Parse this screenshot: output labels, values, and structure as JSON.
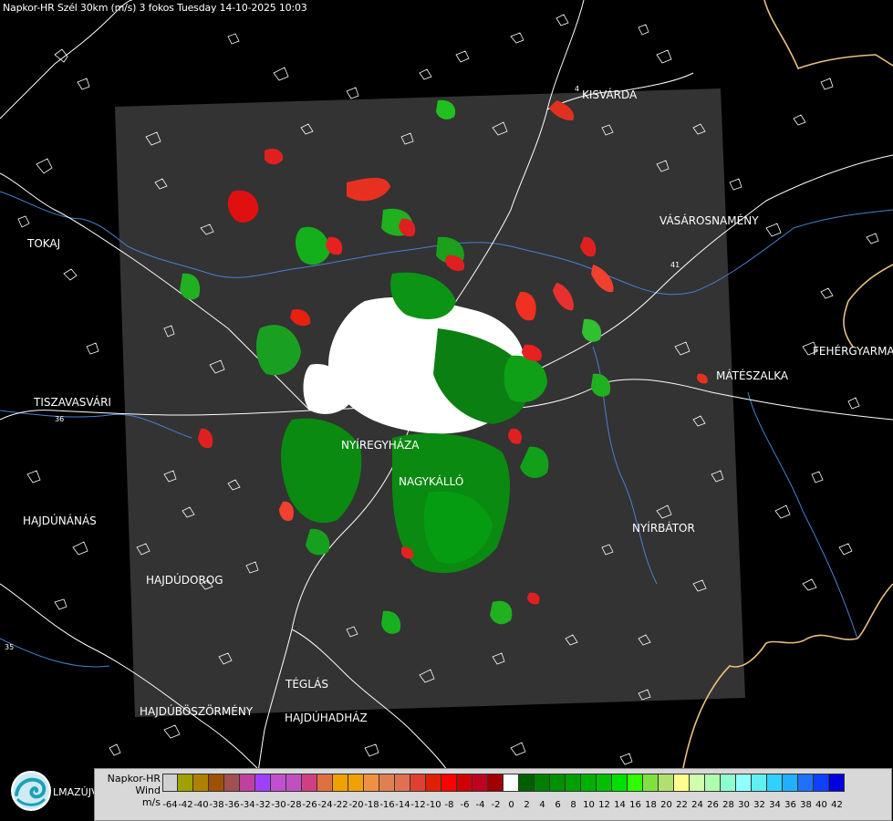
{
  "header": {
    "title": "Napkor-HR Szél 30km (m/s) 3 fokos Tuesday 14-10-2025 10:03"
  },
  "cities": [
    {
      "name": "KISVÁRDA",
      "id": "kisvarda"
    },
    {
      "name": "VÁSÁROSNAMÉNY",
      "id": "vasarosnameny"
    },
    {
      "name": "TOKAJ",
      "id": "tokaj"
    },
    {
      "name": "FEHÉRGYARMAT",
      "id": "fehergyarmat"
    },
    {
      "name": "MÁTÉSZALKA",
      "id": "mateszalka"
    },
    {
      "name": "TISZAVASVÁRI",
      "id": "tiszavasvari"
    },
    {
      "name": "NYÍREGYHÁZA",
      "id": "nyiregyhaza"
    },
    {
      "name": "NAGYKÁLLÓ",
      "id": "nagykallo"
    },
    {
      "name": "HAJDÚNÁNÁS",
      "id": "hajdunanas"
    },
    {
      "name": "NYÍRBÁTOR",
      "id": "nyirbator"
    },
    {
      "name": "HAJDÚDOROG",
      "id": "hajdudorog"
    },
    {
      "name": "TÉGLÁS",
      "id": "teglas"
    },
    {
      "name": "HAJDÚBÖSZÖRMÉNY",
      "id": "hajduboszormeny"
    },
    {
      "name": "HAJDÚHADHÁZ",
      "id": "hajduhadhaz"
    }
  ],
  "roads": [
    "4",
    "41",
    "36",
    "35"
  ],
  "legend": {
    "title_lines": [
      "Napkor-HR",
      "Wind",
      "m/s"
    ],
    "ticks": [
      "-64",
      "-42",
      "-40",
      "-38",
      "-36",
      "-34",
      "-32",
      "-30",
      "-28",
      "-26",
      "-24",
      "-22",
      "-20",
      "-18",
      "-16",
      "-14",
      "-12",
      "-10",
      "-8",
      "-6",
      "-4",
      "-2",
      "0",
      "2",
      "4",
      "6",
      "8",
      "10",
      "12",
      "14",
      "16",
      "18",
      "20",
      "22",
      "24",
      "26",
      "28",
      "30",
      "32",
      "34",
      "36",
      "38",
      "40",
      "42"
    ],
    "colors": [
      "#d0d0d0",
      "#a0a000",
      "#b08000",
      "#a05000",
      "#a05050",
      "#c040a0",
      "#a040ff",
      "#c050d0",
      "#c050c0",
      "#d04080",
      "#e07040",
      "#f0a000",
      "#f0a000",
      "#f09040",
      "#e08050",
      "#e07050",
      "#e04030",
      "#e02000",
      "#ff0000",
      "#d00000",
      "#c00020",
      "#a00000",
      "#ffffff",
      "#006000",
      "#008000",
      "#009000",
      "#00a000",
      "#00b000",
      "#00c000",
      "#00e000",
      "#30ff00",
      "#80e040",
      "#b0e070",
      "#ffff90",
      "#d0ffb0",
      "#b0ffb0",
      "#90ffd0",
      "#90ffff",
      "#60f0f0",
      "#30d0ff",
      "#20b0ff",
      "#2070ff",
      "#1040ff",
      "#0000e0"
    ]
  },
  "logo": {
    "text": "LMAZÚJVÁR"
  }
}
